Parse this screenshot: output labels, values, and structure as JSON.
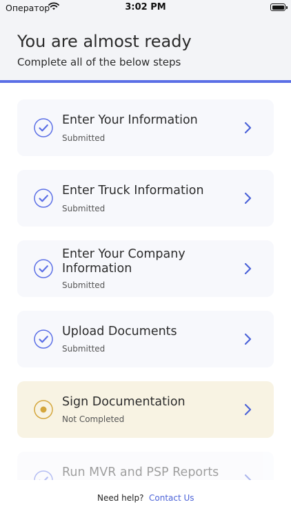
{
  "status_bar": {
    "carrier": "Оператор",
    "time": "3:02 PM",
    "wifi_icon": "wifi-icon",
    "battery_icon": "battery-icon"
  },
  "header": {
    "title": "You are almost ready",
    "subtitle": "Complete all of the below steps"
  },
  "colors": {
    "accent": "#5b6fe6",
    "completed_icon": "#5b6fe6",
    "pending_icon": "#d4a63c",
    "pending_bg": "#f8f3e3",
    "card_bg": "#f7f8fc",
    "link": "#4b62d8"
  },
  "steps": [
    {
      "title_lines": [
        "Enter Your Information"
      ],
      "status": "Submitted",
      "state": "completed",
      "icon": "check-circle-icon"
    },
    {
      "title_lines": [
        "Enter Truck Information"
      ],
      "status": "Submitted",
      "state": "completed",
      "icon": "check-circle-icon"
    },
    {
      "title_lines": [
        "Enter Your Company",
        "Information"
      ],
      "status": "Submitted",
      "state": "completed",
      "icon": "check-circle-icon"
    },
    {
      "title_lines": [
        "Upload Documents"
      ],
      "status": "Submitted",
      "state": "completed",
      "icon": "check-circle-icon"
    },
    {
      "title_lines": [
        "Sign Documentation"
      ],
      "status": "Not Completed",
      "state": "pending",
      "icon": "radio-dot-icon"
    },
    {
      "title_lines": [
        "Run MVR and PSP Reports"
      ],
      "status": "",
      "state": "completed",
      "icon": "check-circle-icon"
    }
  ],
  "footer": {
    "help_text": "Need help?",
    "contact_label": "Contact Us"
  }
}
